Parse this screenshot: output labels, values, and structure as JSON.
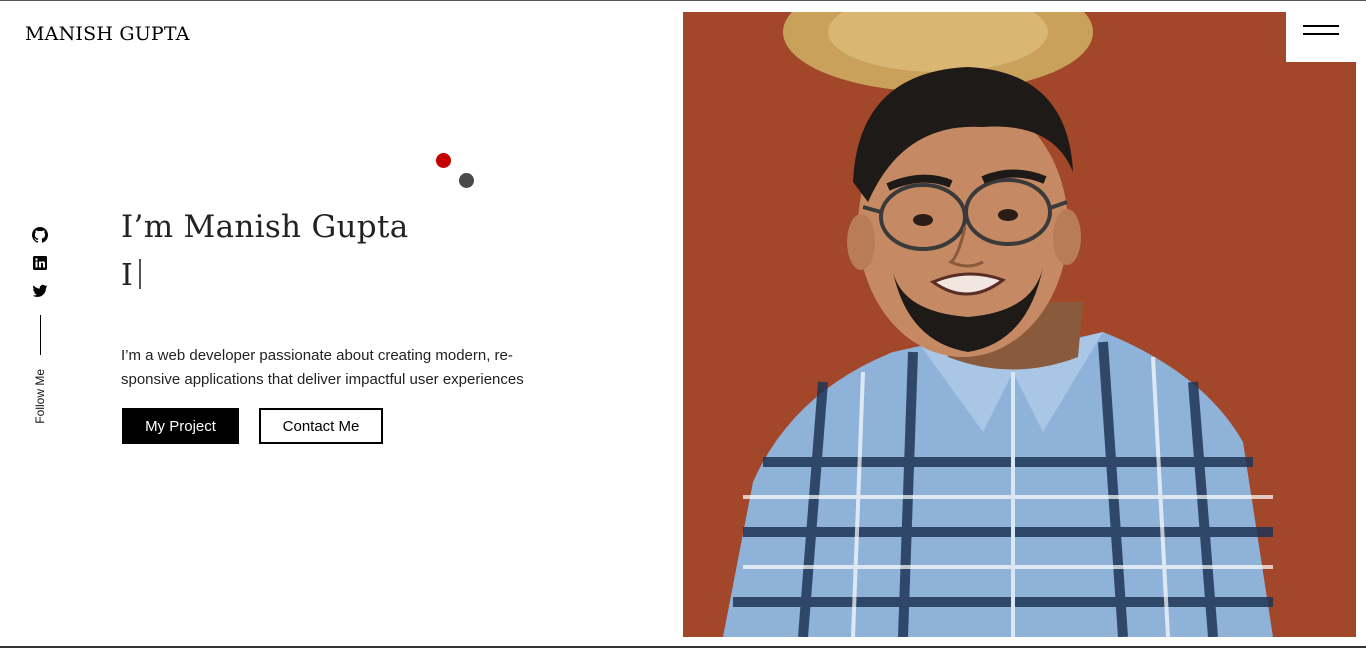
{
  "brand": "MANISH GUPTA",
  "social": {
    "items": [
      {
        "name": "github",
        "icon": "github-icon"
      },
      {
        "name": "linkedin",
        "icon": "linkedin-icon"
      },
      {
        "name": "twitter",
        "icon": "twitter-icon"
      }
    ],
    "label": "Follow Me"
  },
  "hero": {
    "title": "I’m Manish Gupta",
    "typed_text": "I",
    "description": "I’m a web developer passionate about creating modern, re-sponsive applications that deliver impactful user experiences"
  },
  "buttons": {
    "primary": "My Project",
    "secondary": "Contact Me"
  },
  "menu": {
    "icon": "hamburger-menu-icon"
  },
  "colors": {
    "accent_dot": "#c40000",
    "secondary_dot": "#4a4a4a",
    "primary_button_bg": "#000000",
    "portrait_background": "#9c4327"
  }
}
